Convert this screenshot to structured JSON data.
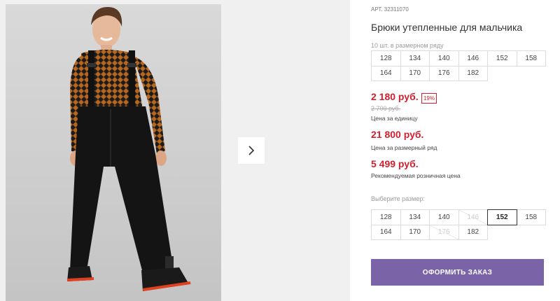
{
  "product": {
    "art_label": "АРТ.",
    "art_number": "32311070",
    "title": "Брюки утепленные для мальчика"
  },
  "gallery": {
    "next_icon": "chevron-right-icon",
    "image_alt": "Мальчик в утепленных брюках на лямках"
  },
  "size_range": {
    "hint": "10 шт. в размерном ряду",
    "sizes": [
      "128",
      "134",
      "140",
      "146",
      "152",
      "158",
      "164",
      "170",
      "176",
      "182"
    ]
  },
  "prices": {
    "unit_price": "2 180 руб.",
    "discount": "19%",
    "old_price": "2 700 руб.",
    "unit_label": "Цена за единицу",
    "range_price": "21 800 руб.",
    "range_label": "Цена за размерный ряд",
    "retail_price": "5 499 руб.",
    "retail_label": "Рекомендуемая розничная цена",
    "accent_color": "#d21f2f"
  },
  "size_select": {
    "label": "Выберите размер:",
    "sizes": [
      {
        "label": "128",
        "state": "available"
      },
      {
        "label": "134",
        "state": "available"
      },
      {
        "label": "140",
        "state": "available"
      },
      {
        "label": "146",
        "state": "disabled"
      },
      {
        "label": "152",
        "state": "selected"
      },
      {
        "label": "158",
        "state": "available"
      },
      {
        "label": "164",
        "state": "available"
      },
      {
        "label": "170",
        "state": "available"
      },
      {
        "label": "176",
        "state": "disabled"
      },
      {
        "label": "182",
        "state": "available"
      }
    ]
  },
  "order_button": {
    "label": "Оформить заказ",
    "color": "#7b63a8"
  }
}
